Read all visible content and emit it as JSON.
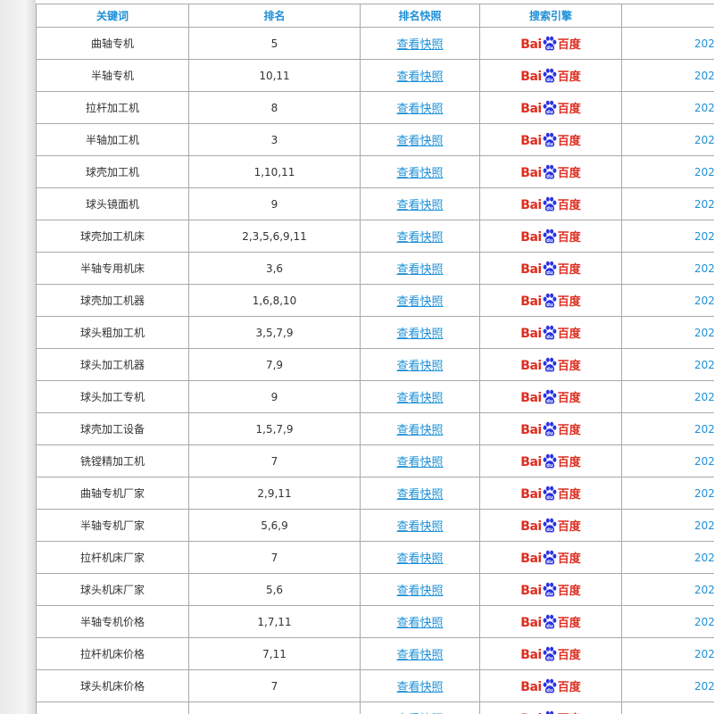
{
  "table": {
    "headers": [
      "关键词",
      "排名",
      "排名快照",
      "搜索引擎",
      ""
    ],
    "rows": [
      {
        "keyword": "曲轴专机",
        "rank": "5",
        "snapshot": "查看快照",
        "engine": "Baidu",
        "date": "202"
      },
      {
        "keyword": "半轴专机",
        "rank": "10,11",
        "snapshot": "查看快照",
        "engine": "Baidu",
        "date": "202"
      },
      {
        "keyword": "拉杆加工机",
        "rank": "8",
        "snapshot": "查看快照",
        "engine": "Baidu",
        "date": "202"
      },
      {
        "keyword": "半轴加工机",
        "rank": "3",
        "snapshot": "查看快照",
        "engine": "Baidu",
        "date": "202"
      },
      {
        "keyword": "球壳加工机",
        "rank": "1,10,11",
        "snapshot": "查看快照",
        "engine": "Baidu",
        "date": "202"
      },
      {
        "keyword": "球头镜面机",
        "rank": "9",
        "snapshot": "查看快照",
        "engine": "Baidu",
        "date": "202"
      },
      {
        "keyword": "球壳加工机床",
        "rank": "2,3,5,6,9,11",
        "snapshot": "查看快照",
        "engine": "Baidu",
        "date": "202"
      },
      {
        "keyword": "半轴专用机床",
        "rank": "3,6",
        "snapshot": "查看快照",
        "engine": "Baidu",
        "date": "202"
      },
      {
        "keyword": "球壳加工机器",
        "rank": "1,6,8,10",
        "snapshot": "查看快照",
        "engine": "Baidu",
        "date": "202"
      },
      {
        "keyword": "球头粗加工机",
        "rank": "3,5,7,9",
        "snapshot": "查看快照",
        "engine": "Baidu",
        "date": "202"
      },
      {
        "keyword": "球头加工机器",
        "rank": "7,9",
        "snapshot": "查看快照",
        "engine": "Baidu",
        "date": "202"
      },
      {
        "keyword": "球头加工专机",
        "rank": "9",
        "snapshot": "查看快照",
        "engine": "Baidu",
        "date": "202"
      },
      {
        "keyword": "球壳加工设备",
        "rank": "1,5,7,9",
        "snapshot": "查看快照",
        "engine": "Baidu",
        "date": "202"
      },
      {
        "keyword": "铣镗精加工机",
        "rank": "7",
        "snapshot": "查看快照",
        "engine": "Baidu",
        "date": "202"
      },
      {
        "keyword": "曲轴专机厂家",
        "rank": "2,9,11",
        "snapshot": "查看快照",
        "engine": "Baidu",
        "date": "202"
      },
      {
        "keyword": "半轴专机厂家",
        "rank": "5,6,9",
        "snapshot": "查看快照",
        "engine": "Baidu",
        "date": "202"
      },
      {
        "keyword": "拉杆机床厂家",
        "rank": "7",
        "snapshot": "查看快照",
        "engine": "Baidu",
        "date": "202"
      },
      {
        "keyword": "球头机床厂家",
        "rank": "5,6",
        "snapshot": "查看快照",
        "engine": "Baidu",
        "date": "202"
      },
      {
        "keyword": "半轴专机价格",
        "rank": "1,7,11",
        "snapshot": "查看快照",
        "engine": "Baidu",
        "date": "202"
      },
      {
        "keyword": "拉杆机床价格",
        "rank": "7,11",
        "snapshot": "查看快照",
        "engine": "Baidu",
        "date": "202"
      },
      {
        "keyword": "球头机床价格",
        "rank": "7",
        "snapshot": "查看快照",
        "engine": "Baidu",
        "date": "202"
      },
      {
        "keyword": "",
        "rank": "",
        "snapshot": "查看快照",
        "engine": "Baidu",
        "date": ""
      }
    ]
  },
  "baidu_logo": {
    "bai": "Bai",
    "du": "百度",
    "icon": "baidu-paw-icon"
  },
  "colors": {
    "header_text": "#1e90d6",
    "link": "#1e90d6",
    "baidu_red": "#de2e21",
    "baidu_blue": "#2932e1",
    "grid": "#a9a9a9"
  }
}
